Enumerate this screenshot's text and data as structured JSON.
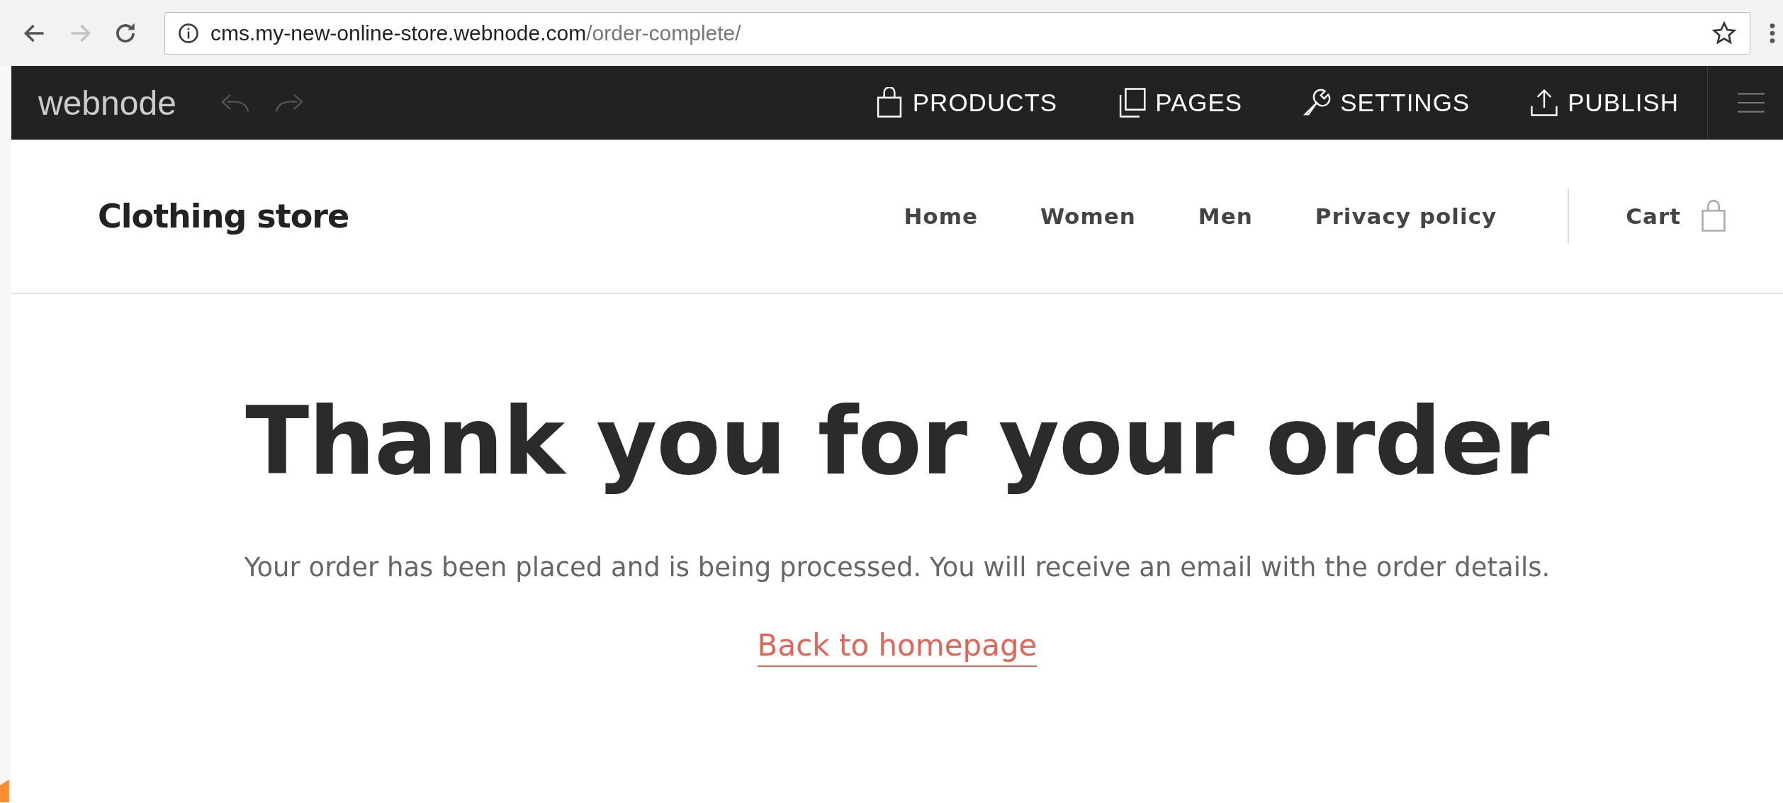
{
  "browser": {
    "url_host": "cms.my-new-online-store.webnode.com",
    "url_path": "/order-complete/"
  },
  "editor_toolbar": {
    "logo": "webnode",
    "actions": [
      {
        "kind": "products",
        "label": "PRODUCTS"
      },
      {
        "kind": "pages",
        "label": "PAGES"
      },
      {
        "kind": "settings",
        "label": "SETTINGS"
      },
      {
        "kind": "publish",
        "label": "PUBLISH"
      }
    ]
  },
  "site_header": {
    "title": "Clothing store",
    "nav": [
      "Home",
      "Women",
      "Men",
      "Privacy policy"
    ],
    "cart": "Cart"
  },
  "content": {
    "heading": "Thank you for your order",
    "message": "Your order has been placed and is being processed. You will receive an email with the order details.",
    "link": "Back to homepage"
  }
}
